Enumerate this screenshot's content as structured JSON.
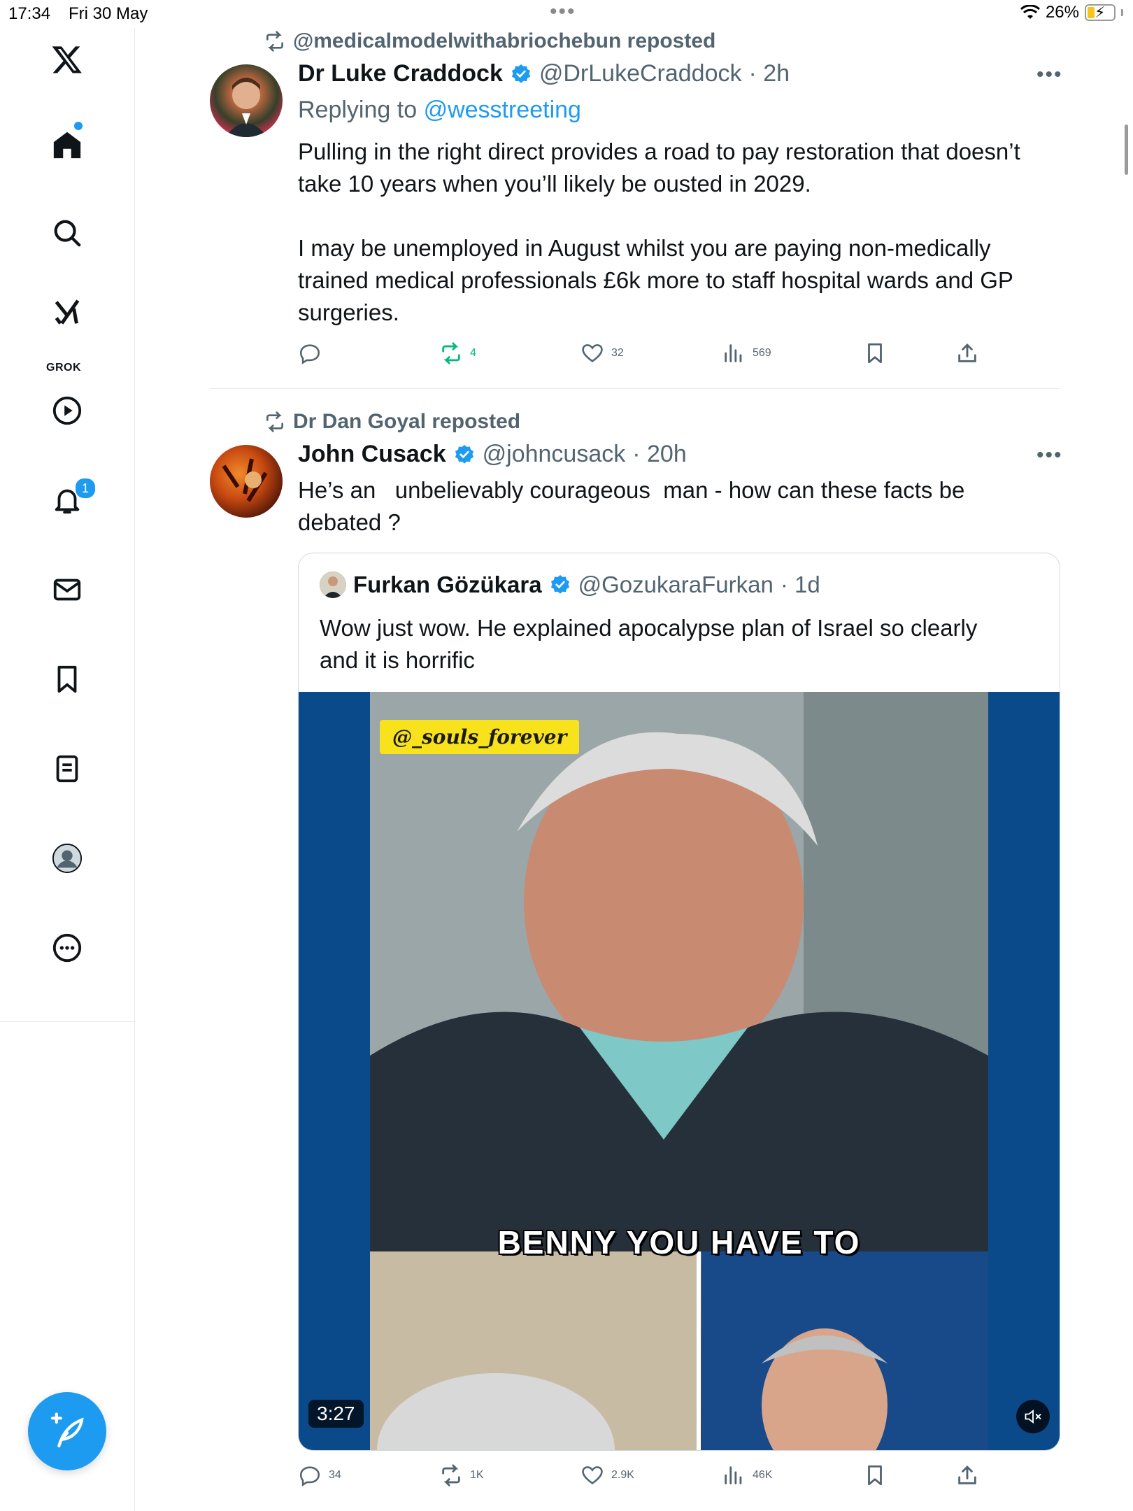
{
  "status_bar": {
    "time": "17:34",
    "date": "Fri 30 May",
    "battery_percent": "26%"
  },
  "sidebar": {
    "grok_label": "GROK",
    "notifications_badge": "1"
  },
  "tweets": [
    {
      "repost_by": "@medicalmodelwithabriochebun reposted",
      "author_name": "Dr Luke Craddock",
      "author_handle": "@DrLukeCraddock",
      "time": "· 2h",
      "replying_label": "Replying to",
      "replying_to": "@wesstreeting",
      "text": "Pulling in the right direct provides a road to pay restoration that doesn’t\ntake 10 years when you’ll likely be ousted in 2029.\n\nI may be unemployed in August whilst you are paying non-medically\ntrained medical professionals £6k more to staff hospital wards and GP\nsurgeries.",
      "reposts": "4",
      "likes": "32",
      "views": "569"
    },
    {
      "repost_by": "Dr Dan Goyal reposted",
      "author_name": "John Cusack",
      "author_handle": "@johncusack",
      "time": "· 20h",
      "text": "He’s an   unbelievably courageous  man - how can these facts be\ndebated ?",
      "quote": {
        "author_name": "Furkan Gözükara",
        "author_handle": "@GozukaraFurkan",
        "time": "· 1d",
        "text": "Wow just wow. He explained apocalypse plan of Israel so clearly\nand it is horrific",
        "video_watermark": "@_souls_forever",
        "video_caption": "BENNY YOU HAVE TO",
        "video_duration": "3:27"
      },
      "replies": "34",
      "reposts": "1K",
      "likes": "2.9K",
      "views": "46K"
    }
  ],
  "colors": {
    "accent": "#1d9bf0",
    "muted": "#536471",
    "repost_green": "#00ba7c"
  }
}
